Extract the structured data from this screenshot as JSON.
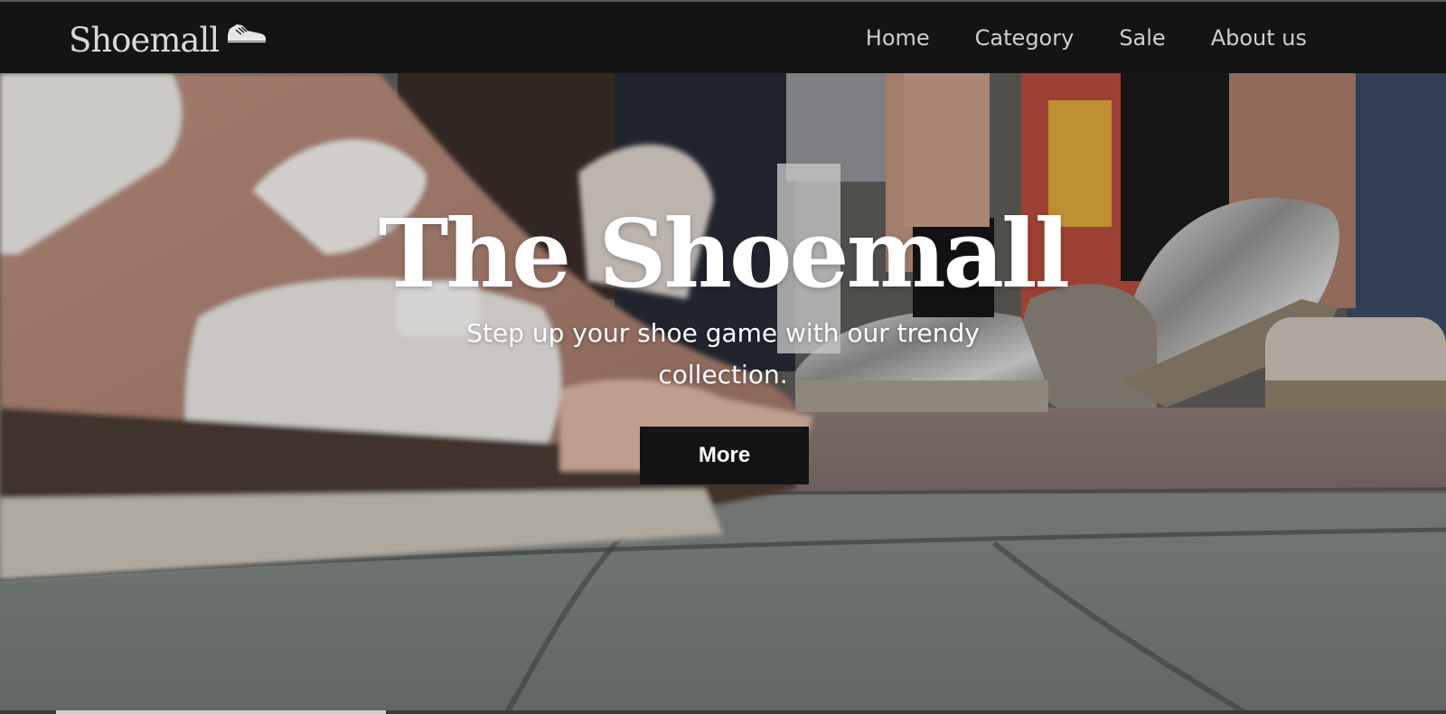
{
  "navbar": {
    "brand": "Shoemall",
    "brand_icon": "sneaker-icon",
    "links": [
      "Home",
      "Category",
      "Sale",
      "About us"
    ]
  },
  "hero": {
    "title": "The Shoemall",
    "subtitle": "Step up your shoe game with our trendy collection.",
    "button_label": "More"
  },
  "colors": {
    "navbar_bg": "#141414",
    "nav_text": "#cfcfcf",
    "button_bg": "#141414",
    "hero_text": "#ffffff"
  }
}
